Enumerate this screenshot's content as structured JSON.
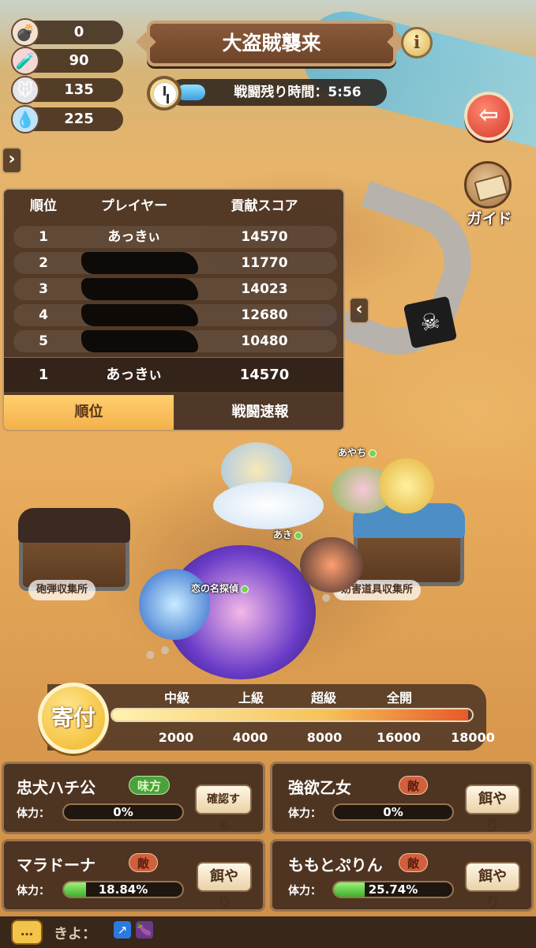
{
  "resources": [
    {
      "icon": "bomb-icon",
      "value": "0"
    },
    {
      "icon": "potion-icon",
      "value": "90"
    },
    {
      "icon": "mouse-icon",
      "value": "135"
    },
    {
      "icon": "crystal-icon",
      "value": "225"
    }
  ],
  "header": {
    "title": "大盗賊襲来",
    "info_label": "i"
  },
  "timer": {
    "text": "戦闘残り時間：5:56",
    "remaining_fraction": 0.16
  },
  "buttons": {
    "exit_label": "⇦",
    "guide_label": "ガイド",
    "expand_left": "›",
    "collapse_panel": "‹"
  },
  "ranking": {
    "headers": {
      "rank": "順位",
      "player": "プレイヤー",
      "score": "貢献スコア"
    },
    "rows": [
      {
        "rank": "1",
        "player": "あっきぃ",
        "score": "14570",
        "redacted": false
      },
      {
        "rank": "2",
        "player": "",
        "score": "11770",
        "redacted": true
      },
      {
        "rank": "3",
        "player": "",
        "score": "14023",
        "redacted": true
      },
      {
        "rank": "4",
        "player": "",
        "score": "12680",
        "redacted": true
      },
      {
        "rank": "5",
        "player": "",
        "score": "10480",
        "redacted": true
      }
    ],
    "self": {
      "rank": "1",
      "player": "あっきぃ",
      "score": "14570"
    },
    "tabs": {
      "active": "順位",
      "inactive": "戦闘速報"
    }
  },
  "map": {
    "zones": {
      "left": "砲弾収集所",
      "right": "妨害道具収集所"
    },
    "players": {
      "p1": "あやち",
      "p2": "あき",
      "p3": "恋の名探偵"
    }
  },
  "donation": {
    "button_label": "寄付",
    "tiers": [
      "中級",
      "上級",
      "超級",
      "全開"
    ],
    "thresholds": [
      "2000",
      "4000",
      "8000",
      "16000",
      "18000"
    ],
    "progress_fraction": 0.99
  },
  "bosses": [
    {
      "name": "忠犬ハチ公",
      "badge": "味方",
      "side": "ally",
      "hp_label": "体力：",
      "hp": "0%",
      "hp_fraction": 0,
      "action": "確認する"
    },
    {
      "name": "強欲乙女",
      "badge": "敵",
      "side": "enemy",
      "hp_label": "体力：",
      "hp": "0%",
      "hp_fraction": 0,
      "action": "餌やり"
    },
    {
      "name": "マラドーナ",
      "badge": "敵",
      "side": "enemy",
      "hp_label": "体力：",
      "hp": "18.84%",
      "hp_fraction": 0.1884,
      "action": "餌やり"
    },
    {
      "name": "ももとぷりん",
      "badge": "敵",
      "side": "enemy",
      "hp_label": "体力：",
      "hp": "25.74%",
      "hp_fraction": 0.2574,
      "action": "餌やり"
    }
  ],
  "chat": {
    "icon_label": "…",
    "preview": "きよ："
  },
  "colors": {
    "panel": "#46301f",
    "accent": "#f4b049",
    "ally": "#4aa23a",
    "enemy": "#d1603c",
    "hp": "#3eb12c"
  }
}
